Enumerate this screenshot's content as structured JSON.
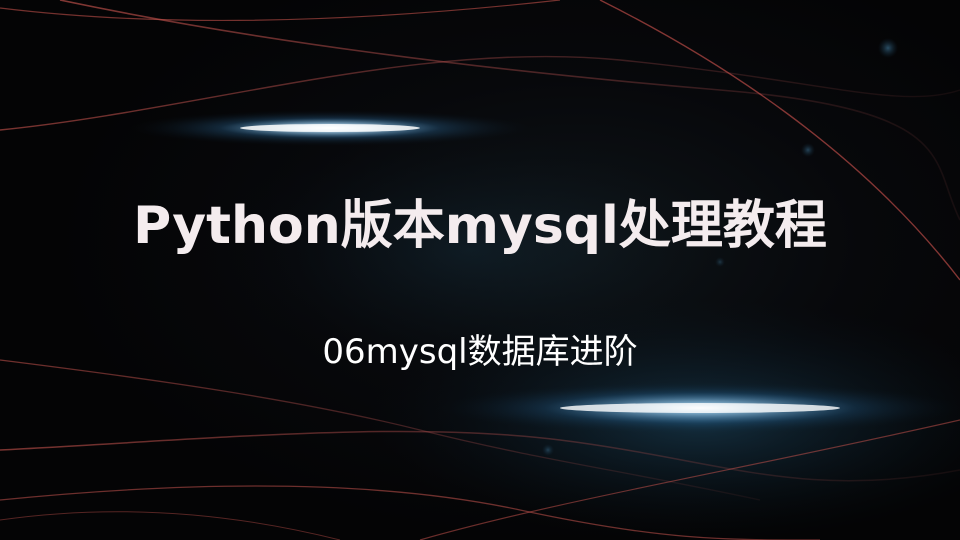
{
  "slide": {
    "title": "Python版本mysql处理教程",
    "subtitle": "06mysql数据库进阶"
  },
  "colors": {
    "background": "#050507",
    "title_text": "#f4ecee",
    "subtitle_text": "#ffffff",
    "glow": "#8fd0ff",
    "light_streak": "#c0504a"
  }
}
